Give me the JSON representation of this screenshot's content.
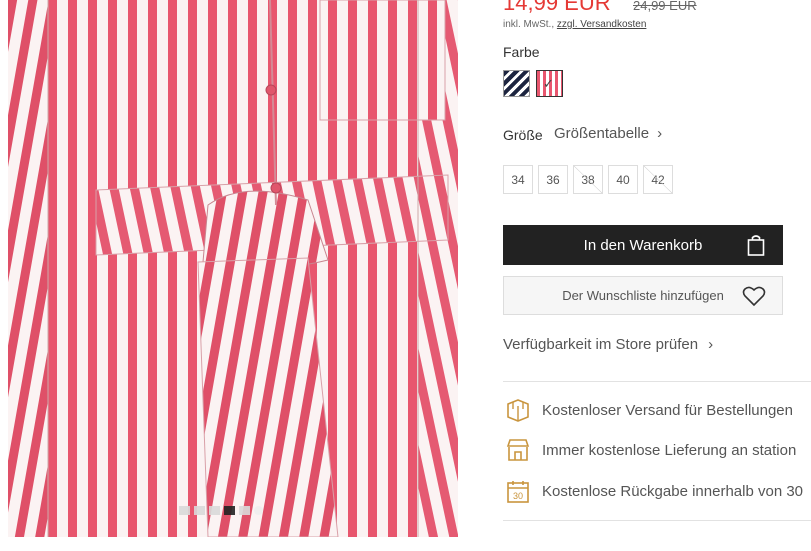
{
  "product": {
    "price": "14,99 EUR",
    "old_price": "24,99 EUR",
    "tax_note": "inkl. MwSt.,",
    "shipping_link": "zzgl. Versandkosten"
  },
  "color": {
    "label": "Farbe",
    "swatches": [
      "navy-stripe",
      "pink-stripe"
    ],
    "selected": "pink-stripe"
  },
  "size": {
    "label": "Größe",
    "chart_link": "Größentabelle",
    "options": [
      {
        "label": "34",
        "available": true
      },
      {
        "label": "36",
        "available": true
      },
      {
        "label": "38",
        "available": false
      },
      {
        "label": "40",
        "available": true
      },
      {
        "label": "42",
        "available": false
      }
    ]
  },
  "actions": {
    "add_to_cart": "In den Warenkorb",
    "wishlist": "Der Wunschliste hinzufügen",
    "store_check": "Verfügbarkeit im Store prüfen"
  },
  "benefits": [
    {
      "icon": "box-icon",
      "text": "Kostenloser Versand für Bestellungen"
    },
    {
      "icon": "store-icon",
      "text": "Immer kostenlose Lieferung an station"
    },
    {
      "icon": "calendar-30-icon",
      "text": "Kostenlose Rückgabe innerhalb von 30"
    }
  ],
  "gallery": {
    "slide_count": 6,
    "active_slide": 4
  },
  "colors": {
    "price_red": "#e53935",
    "stripe_pink": "#e8566e",
    "button_dark": "#222222",
    "benefit_icon": "#c9953e"
  }
}
